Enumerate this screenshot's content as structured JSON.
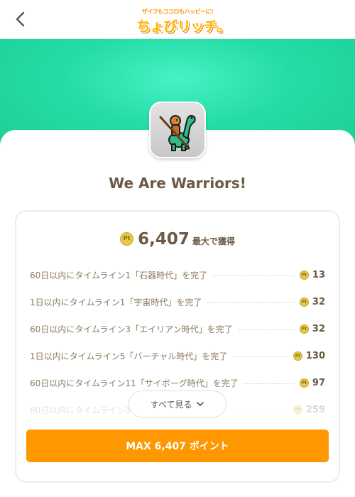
{
  "header": {
    "logo_tagline": "ザイフもココロもハッピーに!",
    "logo_text": "ちょびリッチ。"
  },
  "app": {
    "title": "We Are Warriors!",
    "icon": "warrior-on-dinosaur-icon"
  },
  "points": {
    "total": "6,407",
    "total_caption": "最大で獲得",
    "coin_icon": "pt-coin-icon"
  },
  "missions": [
    {
      "text": "60日以内にタイムライン1「石器時代」を完了",
      "points": "13"
    },
    {
      "text": "1日以内にタイムライン1「宇宙時代」を完了",
      "points": "32"
    },
    {
      "text": "60日以内にタイムライン3「エイリアン時代」を完了",
      "points": "32"
    },
    {
      "text": "1日以内にタイムライン5「バーチャル時代」を完了",
      "points": "130"
    },
    {
      "text": "60日以内にタイムライン11「サイボーグ時代」を完了",
      "points": "97"
    },
    {
      "text": "60日以内にタイムライン3",
      "points": "259"
    }
  ],
  "see_all": {
    "label": "すべて見る"
  },
  "max_button": {
    "label": "MAX 6,407 ポイント"
  },
  "colors": {
    "banner": "#26dca6",
    "accent": "#ff9800",
    "text_brown": "#6b5a45",
    "coin": "#e4c84a"
  }
}
